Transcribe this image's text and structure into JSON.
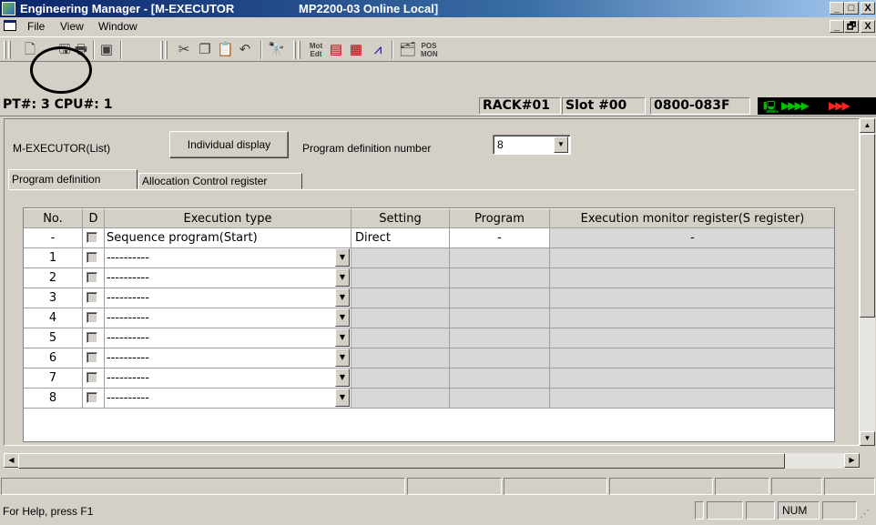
{
  "window": {
    "title": "Engineering Manager - [M-EXECUTOR",
    "title_suffix": "MP2200-03 Online  Local]",
    "min_label": "_",
    "max_label": "□",
    "close_label": "X",
    "child_restore_label": "🗗"
  },
  "menu": {
    "items": [
      "File",
      "View",
      "Window"
    ]
  },
  "toolbar": {
    "icons": [
      "new-icon",
      "save-icon",
      "print-icon",
      "transfer-icon",
      "cut-icon",
      "copy-icon",
      "paste-icon",
      "undo-icon",
      "find-icon",
      "mot-edt-icon",
      "register-list-icon",
      "register-hash-icon",
      "trace-icon",
      "properties-icon",
      "pos-mon-icon"
    ],
    "mot_label": "Mot\nEdt",
    "pos_label": "POS\nMON"
  },
  "status_header": {
    "pt_cpu": "PT#: 3 CPU#: 1",
    "rack": "RACK#01",
    "slot": "Slot #00",
    "range": "0800-083F"
  },
  "panel": {
    "list_label": "M-EXECUTOR(List)",
    "individual_button": "Individual display",
    "prog_def_label": "Program definition number",
    "prog_def_value": "8",
    "tabs": [
      "Program definition",
      "Allocation Control register"
    ]
  },
  "grid": {
    "headers": [
      "No.",
      "D",
      "Execution type",
      "Setting",
      "Program",
      "Execution monitor register(S register)"
    ],
    "first_row": {
      "no": "-",
      "type": "Sequence program(Start)",
      "setting": "Direct",
      "program": "-",
      "monitor": "-"
    },
    "rows": [
      {
        "no": "1",
        "type": "----------"
      },
      {
        "no": "2",
        "type": "----------"
      },
      {
        "no": "3",
        "type": "----------"
      },
      {
        "no": "4",
        "type": "----------"
      },
      {
        "no": "5",
        "type": "----------"
      },
      {
        "no": "6",
        "type": "----------"
      },
      {
        "no": "7",
        "type": "----------"
      },
      {
        "no": "8",
        "type": "----------"
      }
    ]
  },
  "statusbar": {
    "help": "For Help, press F1",
    "num": "NUM"
  },
  "colors": {
    "title_start": "#0a246a",
    "title_end": "#a6caf0",
    "face": "#d4d0c8",
    "grid_grey": "#d8d8d8",
    "status_green": "#00c000",
    "status_red": "#ff2020"
  }
}
